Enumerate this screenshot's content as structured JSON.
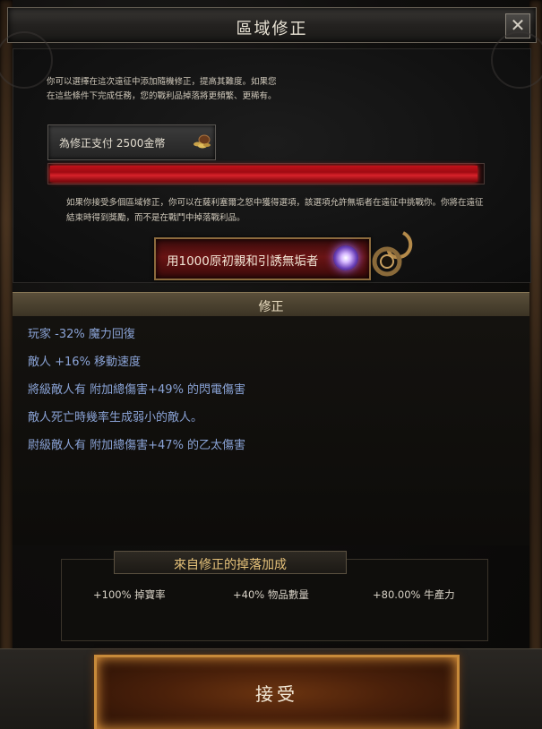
{
  "window": {
    "title": "區域修正",
    "close_label": "✕"
  },
  "intro": {
    "text": "你可以選擇在這次遠征中添加隨機修正，提高其難度。如果您在這些條件下完成任務，您的戰利品掉落將更頻繁、更稀有。"
  },
  "pay": {
    "label": "為修正支付 2500金幣",
    "icon": "coin-pile-icon"
  },
  "progress": {
    "fill_fraction": 0.99,
    "color": "#c1121a"
  },
  "description": {
    "text": "如果你接受多個區域修正，你可以在薩利塞爾之怒中獲得選項，該選項允許無垢者在遠征中挑戰你。你將在遠征結束時得到獎勵，而不是在戰鬥中掉落戰利品。"
  },
  "lure": {
    "label": "用1000原初親和引誘無垢者",
    "icon": "purple-orb-icon",
    "decoration_icon": "ornate-hook-icon"
  },
  "modifiers": {
    "title": "修正",
    "items": [
      "玩家 -32% 魔力回復",
      "敵人 +16% 移動速度",
      "將級敵人有 附加總傷害+49% 的閃電傷害",
      "敵人死亡時幾率生成弱小的敵人。",
      "尉級敵人有 附加總傷害+47% 的乙太傷害"
    ],
    "text_color": "#8aa3d6"
  },
  "drop_bonus": {
    "title": "來自修正的掉落加成",
    "stats": [
      "+100% 掉寶率",
      "+40% 物品數量",
      "+80.00% 牛產力"
    ]
  },
  "accept": {
    "label": "接受"
  }
}
